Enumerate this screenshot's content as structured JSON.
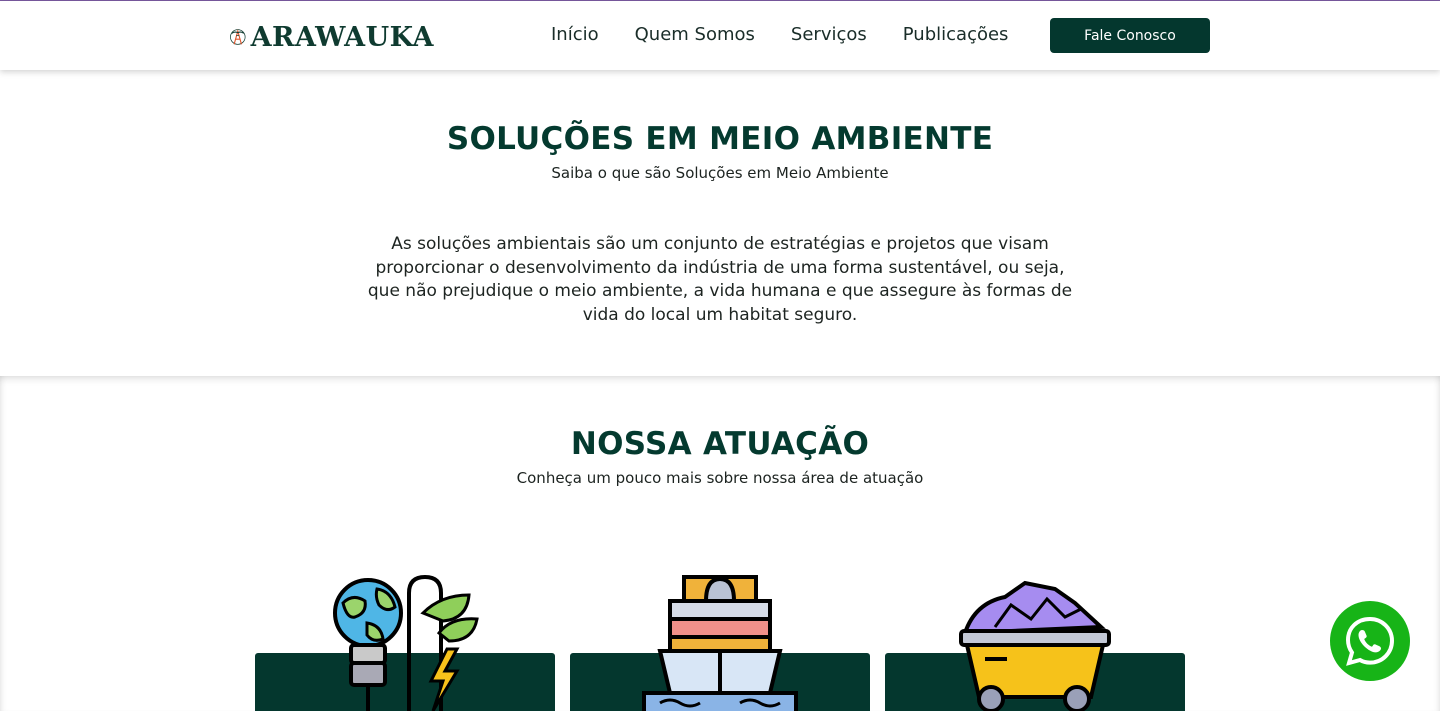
{
  "header": {
    "logo_text": "ARAWAUKA",
    "nav": [
      "Início",
      "Quem Somos",
      "Serviços",
      "Publicações"
    ],
    "cta_label": "Fale Conosco"
  },
  "section1": {
    "title": "SOLUÇÕES EM MEIO AMBIENTE",
    "subtitle": "Saiba o que são Soluções em Meio Ambiente",
    "paragraph": "As soluções ambientais são um conjunto de estratégias e projetos que visam proporcionar o desenvolvimento da indústria de uma forma sustentável, ou seja, que não prejudique o meio ambiente, a vida humana e que assegure às formas de vida do local um habitat seguro."
  },
  "section2": {
    "title": "NOSSA ATUAÇÃO",
    "subtitle": "Conheça um pouco mais sobre nossa área de atuação",
    "cards": [
      {
        "icon": "green-energy-icon"
      },
      {
        "icon": "cargo-ship-icon"
      },
      {
        "icon": "mining-cart-icon"
      }
    ]
  },
  "colors": {
    "brand_dark_green": "#04372e",
    "whatsapp_green": "#17b417"
  },
  "floating": {
    "icon": "whatsapp-icon"
  }
}
